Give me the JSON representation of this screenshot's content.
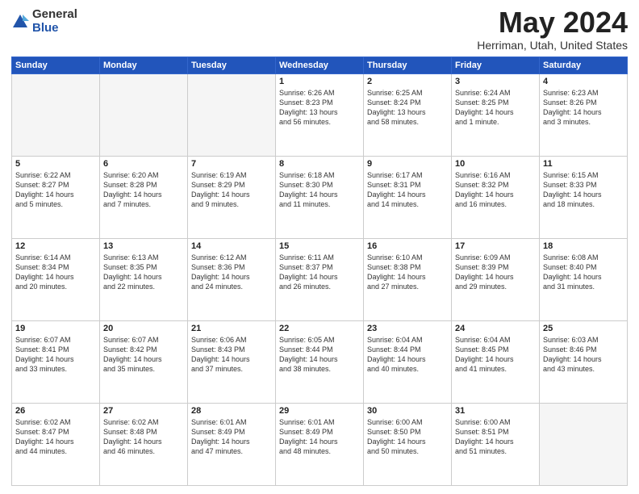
{
  "logo": {
    "general": "General",
    "blue": "Blue"
  },
  "title": {
    "month_year": "May 2024",
    "location": "Herriman, Utah, United States"
  },
  "headers": [
    "Sunday",
    "Monday",
    "Tuesday",
    "Wednesday",
    "Thursday",
    "Friday",
    "Saturday"
  ],
  "weeks": [
    [
      {
        "day": "",
        "info": ""
      },
      {
        "day": "",
        "info": ""
      },
      {
        "day": "",
        "info": ""
      },
      {
        "day": "1",
        "info": "Sunrise: 6:26 AM\nSunset: 8:23 PM\nDaylight: 13 hours\nand 56 minutes."
      },
      {
        "day": "2",
        "info": "Sunrise: 6:25 AM\nSunset: 8:24 PM\nDaylight: 13 hours\nand 58 minutes."
      },
      {
        "day": "3",
        "info": "Sunrise: 6:24 AM\nSunset: 8:25 PM\nDaylight: 14 hours\nand 1 minute."
      },
      {
        "day": "4",
        "info": "Sunrise: 6:23 AM\nSunset: 8:26 PM\nDaylight: 14 hours\nand 3 minutes."
      }
    ],
    [
      {
        "day": "5",
        "info": "Sunrise: 6:22 AM\nSunset: 8:27 PM\nDaylight: 14 hours\nand 5 minutes."
      },
      {
        "day": "6",
        "info": "Sunrise: 6:20 AM\nSunset: 8:28 PM\nDaylight: 14 hours\nand 7 minutes."
      },
      {
        "day": "7",
        "info": "Sunrise: 6:19 AM\nSunset: 8:29 PM\nDaylight: 14 hours\nand 9 minutes."
      },
      {
        "day": "8",
        "info": "Sunrise: 6:18 AM\nSunset: 8:30 PM\nDaylight: 14 hours\nand 11 minutes."
      },
      {
        "day": "9",
        "info": "Sunrise: 6:17 AM\nSunset: 8:31 PM\nDaylight: 14 hours\nand 14 minutes."
      },
      {
        "day": "10",
        "info": "Sunrise: 6:16 AM\nSunset: 8:32 PM\nDaylight: 14 hours\nand 16 minutes."
      },
      {
        "day": "11",
        "info": "Sunrise: 6:15 AM\nSunset: 8:33 PM\nDaylight: 14 hours\nand 18 minutes."
      }
    ],
    [
      {
        "day": "12",
        "info": "Sunrise: 6:14 AM\nSunset: 8:34 PM\nDaylight: 14 hours\nand 20 minutes."
      },
      {
        "day": "13",
        "info": "Sunrise: 6:13 AM\nSunset: 8:35 PM\nDaylight: 14 hours\nand 22 minutes."
      },
      {
        "day": "14",
        "info": "Sunrise: 6:12 AM\nSunset: 8:36 PM\nDaylight: 14 hours\nand 24 minutes."
      },
      {
        "day": "15",
        "info": "Sunrise: 6:11 AM\nSunset: 8:37 PM\nDaylight: 14 hours\nand 26 minutes."
      },
      {
        "day": "16",
        "info": "Sunrise: 6:10 AM\nSunset: 8:38 PM\nDaylight: 14 hours\nand 27 minutes."
      },
      {
        "day": "17",
        "info": "Sunrise: 6:09 AM\nSunset: 8:39 PM\nDaylight: 14 hours\nand 29 minutes."
      },
      {
        "day": "18",
        "info": "Sunrise: 6:08 AM\nSunset: 8:40 PM\nDaylight: 14 hours\nand 31 minutes."
      }
    ],
    [
      {
        "day": "19",
        "info": "Sunrise: 6:07 AM\nSunset: 8:41 PM\nDaylight: 14 hours\nand 33 minutes."
      },
      {
        "day": "20",
        "info": "Sunrise: 6:07 AM\nSunset: 8:42 PM\nDaylight: 14 hours\nand 35 minutes."
      },
      {
        "day": "21",
        "info": "Sunrise: 6:06 AM\nSunset: 8:43 PM\nDaylight: 14 hours\nand 37 minutes."
      },
      {
        "day": "22",
        "info": "Sunrise: 6:05 AM\nSunset: 8:44 PM\nDaylight: 14 hours\nand 38 minutes."
      },
      {
        "day": "23",
        "info": "Sunrise: 6:04 AM\nSunset: 8:44 PM\nDaylight: 14 hours\nand 40 minutes."
      },
      {
        "day": "24",
        "info": "Sunrise: 6:04 AM\nSunset: 8:45 PM\nDaylight: 14 hours\nand 41 minutes."
      },
      {
        "day": "25",
        "info": "Sunrise: 6:03 AM\nSunset: 8:46 PM\nDaylight: 14 hours\nand 43 minutes."
      }
    ],
    [
      {
        "day": "26",
        "info": "Sunrise: 6:02 AM\nSunset: 8:47 PM\nDaylight: 14 hours\nand 44 minutes."
      },
      {
        "day": "27",
        "info": "Sunrise: 6:02 AM\nSunset: 8:48 PM\nDaylight: 14 hours\nand 46 minutes."
      },
      {
        "day": "28",
        "info": "Sunrise: 6:01 AM\nSunset: 8:49 PM\nDaylight: 14 hours\nand 47 minutes."
      },
      {
        "day": "29",
        "info": "Sunrise: 6:01 AM\nSunset: 8:49 PM\nDaylight: 14 hours\nand 48 minutes."
      },
      {
        "day": "30",
        "info": "Sunrise: 6:00 AM\nSunset: 8:50 PM\nDaylight: 14 hours\nand 50 minutes."
      },
      {
        "day": "31",
        "info": "Sunrise: 6:00 AM\nSunset: 8:51 PM\nDaylight: 14 hours\nand 51 minutes."
      },
      {
        "day": "",
        "info": ""
      }
    ]
  ]
}
